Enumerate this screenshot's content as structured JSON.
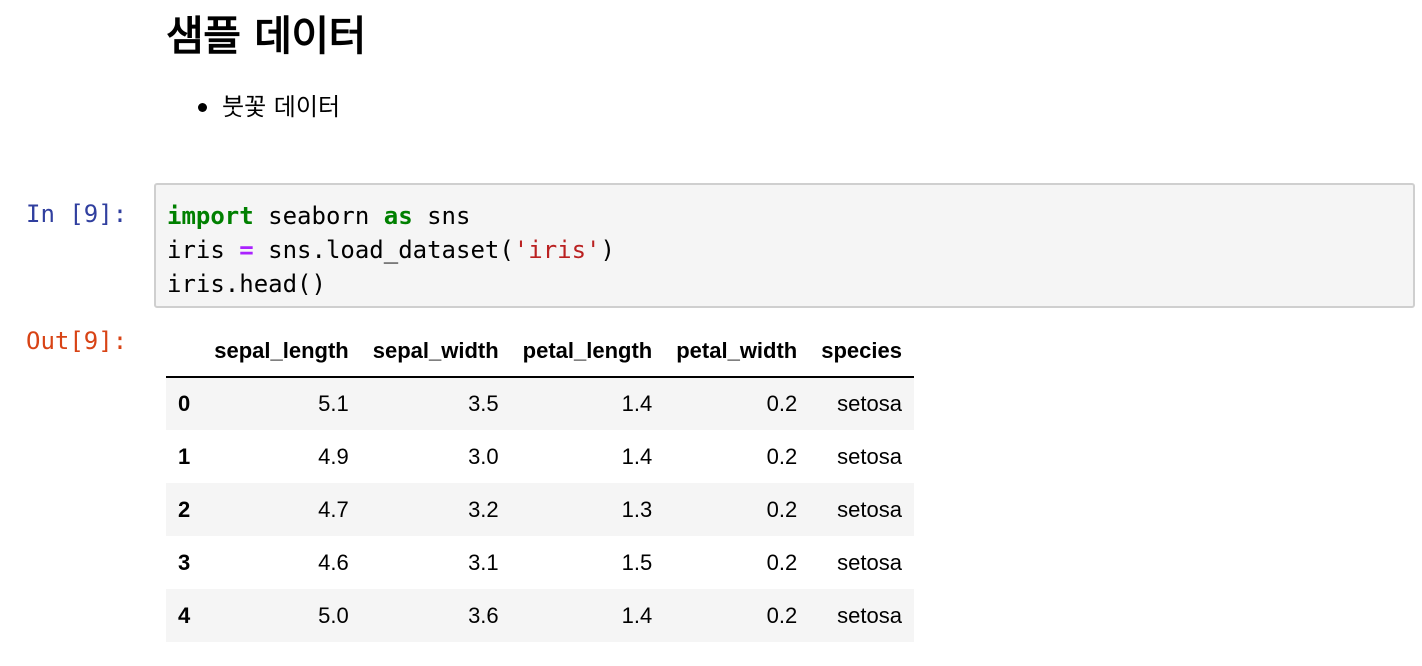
{
  "markdown": {
    "title": "샘플 데이터",
    "bullets": [
      "붓꽃 데이터"
    ]
  },
  "code_cell": {
    "in_prompt": "In [9]:",
    "out_prompt": "Out[9]:",
    "line1": {
      "kw_import": "import",
      "module": " seaborn ",
      "kw_as": "as",
      "alias": " sns"
    },
    "line2": {
      "var": "iris ",
      "op": "=",
      "call": " sns.load_dataset(",
      "arg": "'iris'",
      "close": ")"
    },
    "line3": {
      "text": "iris.head()"
    }
  },
  "dataframe": {
    "columns": [
      "sepal_length",
      "sepal_width",
      "petal_length",
      "petal_width",
      "species"
    ],
    "rows": [
      {
        "index": "0",
        "values": [
          "5.1",
          "3.5",
          "1.4",
          "0.2",
          "setosa"
        ]
      },
      {
        "index": "1",
        "values": [
          "4.9",
          "3.0",
          "1.4",
          "0.2",
          "setosa"
        ]
      },
      {
        "index": "2",
        "values": [
          "4.7",
          "3.2",
          "1.3",
          "0.2",
          "setosa"
        ]
      },
      {
        "index": "3",
        "values": [
          "4.6",
          "3.1",
          "1.5",
          "0.2",
          "setosa"
        ]
      },
      {
        "index": "4",
        "values": [
          "5.0",
          "3.6",
          "1.4",
          "0.2",
          "setosa"
        ]
      }
    ]
  },
  "colors": {
    "in_prompt": "#303f9f",
    "out_prompt": "#d84315",
    "keyword": "#008000",
    "operator": "#aa22ff",
    "string": "#ba2121",
    "code_background": "#f5f5f5",
    "striped_row": "#f5f5f5"
  }
}
